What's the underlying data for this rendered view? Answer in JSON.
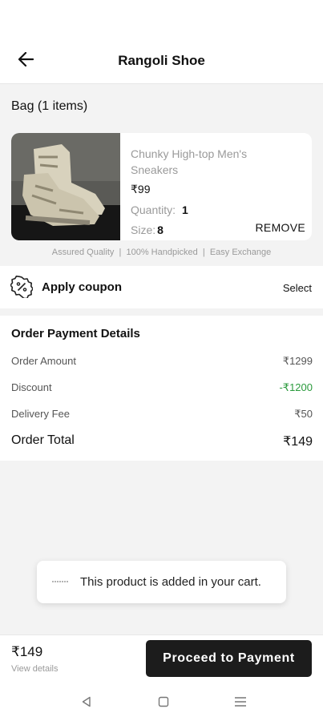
{
  "header": {
    "title": "Rangoli Shoe"
  },
  "bag": {
    "title": "Bag (1 items)"
  },
  "product": {
    "name": "Chunky High-top Men's Sneakers",
    "price": "₹99",
    "quantity_label": "Quantity:",
    "quantity_value": "1",
    "size_label": "Size:",
    "size_value": "8",
    "remove_label": "REMOVE"
  },
  "assurance": "Assured Quality  |  100% Handpicked  |  Easy Exchange",
  "coupon": {
    "label": "Apply coupon",
    "select_label": "Select"
  },
  "payment": {
    "title": "Order Payment Details",
    "rows": [
      {
        "label": "Order Amount",
        "value": "₹1299"
      },
      {
        "label": "Discount",
        "value": "-₹1200"
      },
      {
        "label": "Delivery Fee",
        "value": "₹50"
      }
    ],
    "total_label": "Order Total",
    "total_value": "₹149"
  },
  "toast": {
    "message": "This product is added in your cart."
  },
  "footer": {
    "price": "₹149",
    "view_details": "View details",
    "proceed_label": "Proceed to Payment"
  },
  "colors": {
    "accent": "#1c1c1c",
    "discount": "#2a9a3c",
    "muted": "#9a9a9a"
  },
  "icons": [
    "arrow-left-icon",
    "coupon-percent-icon",
    "nav-back-icon",
    "nav-home-icon",
    "nav-menu-icon"
  ]
}
